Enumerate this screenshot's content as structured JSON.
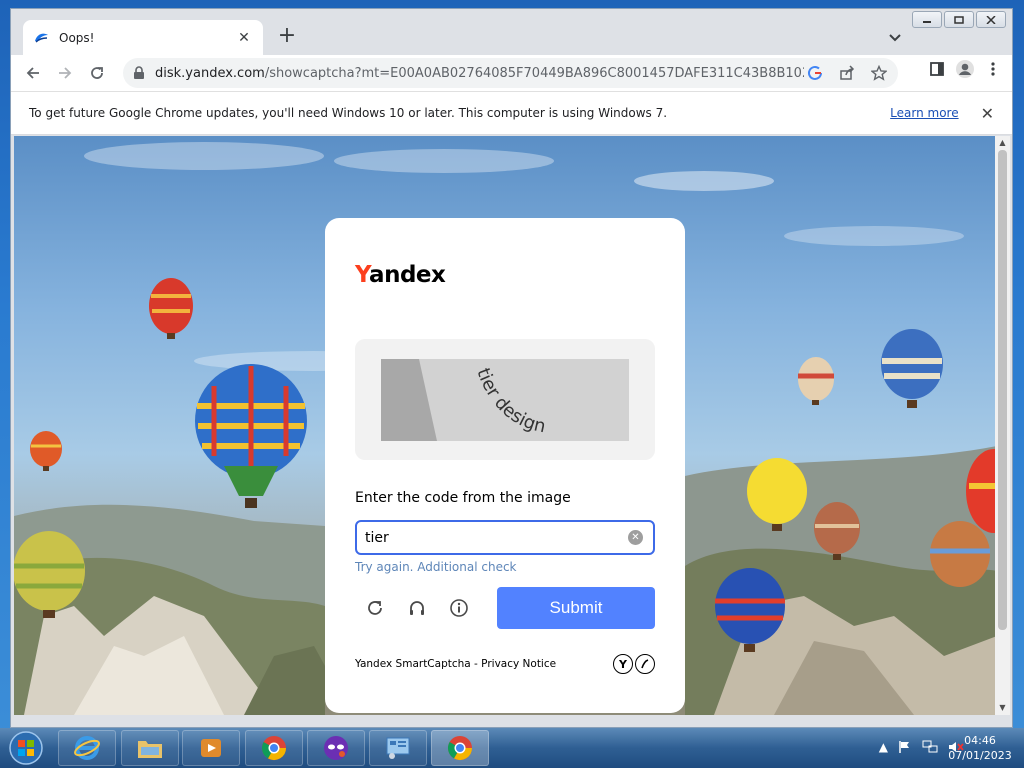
{
  "browser": {
    "tab_title": "Oops!",
    "url_host": "disk.yandex.com",
    "url_path": "/showcaptcha?mt=E00A0AB02764085F70449BA896C8001457DAFE311C43B8B1024...",
    "infobar_text": "To get future Google Chrome updates, you'll need Windows 10 or later. This computer is using Windows 7.",
    "infobar_link": "Learn more"
  },
  "captcha": {
    "logo_first": "Y",
    "logo_rest": "andex",
    "image_text": "tier design",
    "prompt": "Enter the code from the image",
    "input_value": "tier",
    "hint": "Try again. Additional check",
    "submit_label": "Submit",
    "footer": "Yandex SmartCaptcha - Privacy Notice"
  },
  "taskbar": {
    "time": "04:46",
    "date": "07/01/2023"
  },
  "colors": {
    "accent": "#5282ff",
    "brand_red": "#fc3f1d",
    "hint": "#5e86b8"
  }
}
